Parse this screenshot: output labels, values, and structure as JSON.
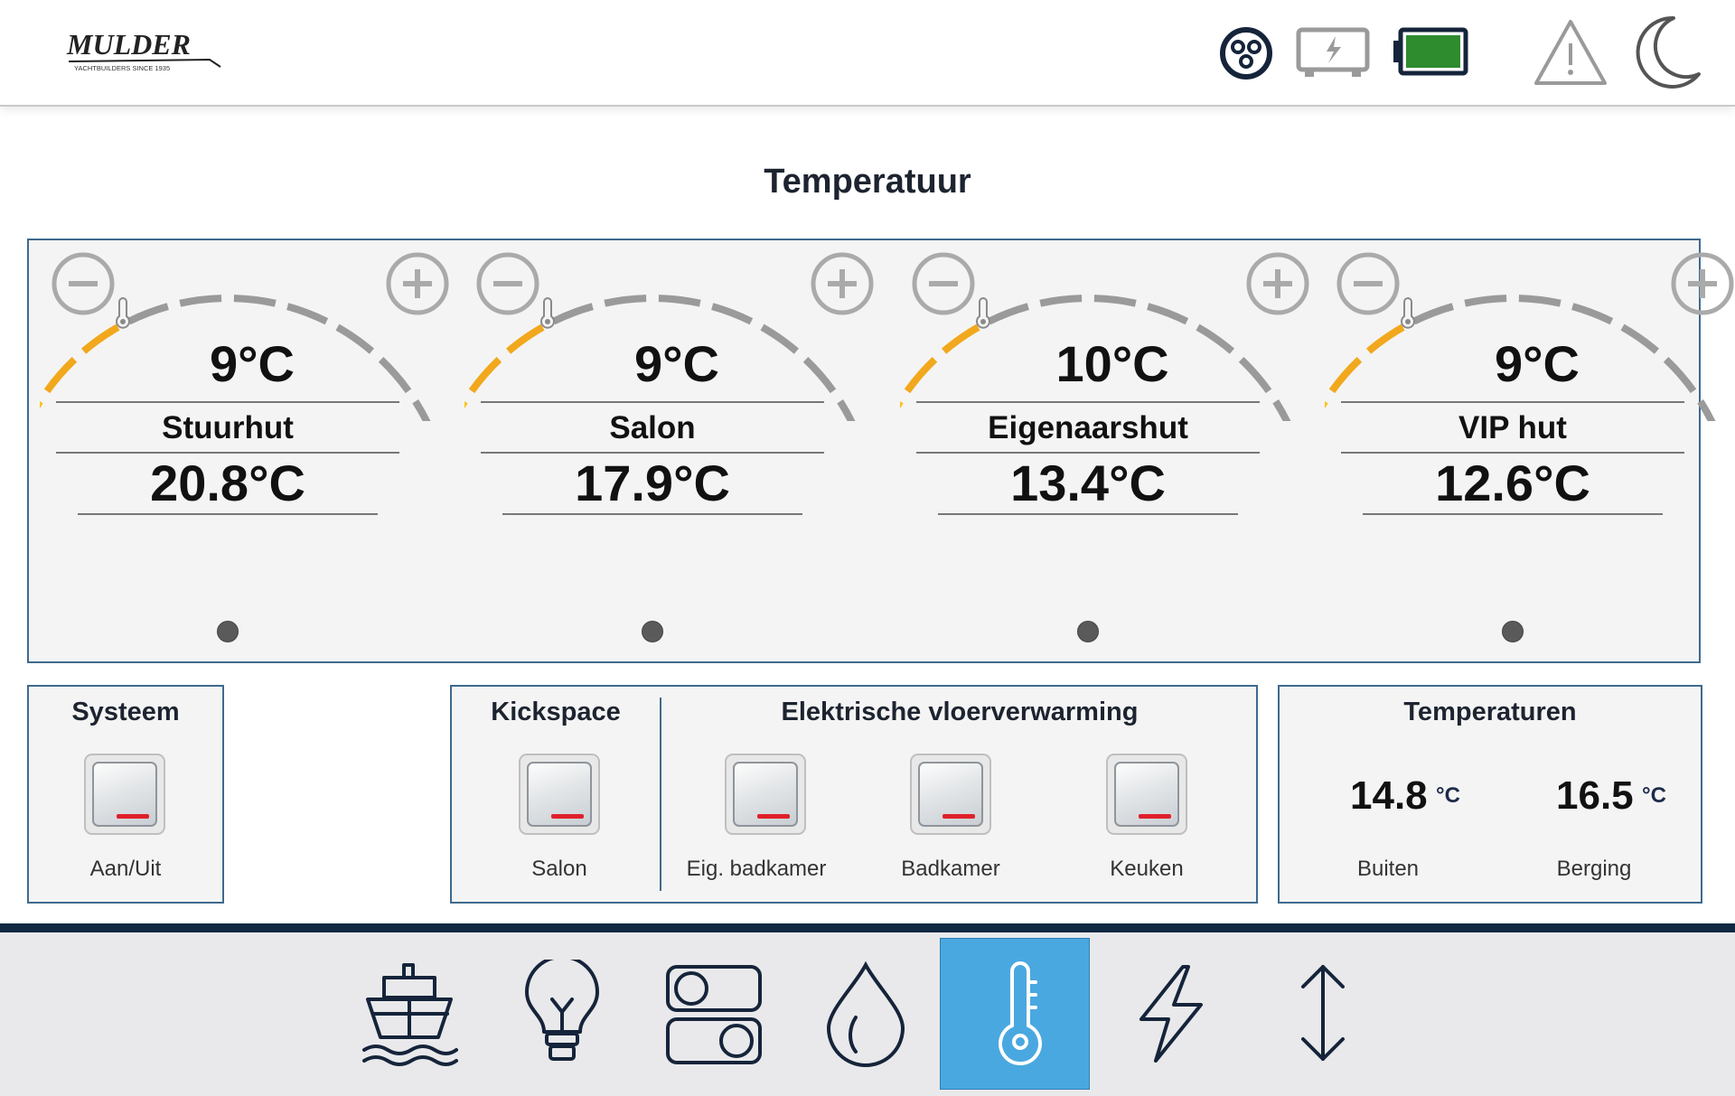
{
  "header": {
    "logo_text": "MULDER",
    "logo_subtext": "YACHTBUILDERS SINCE 1935",
    "status_icons": [
      "shore-power-icon",
      "charger-icon",
      "battery-icon",
      "warning-icon",
      "night-mode-icon"
    ],
    "battery_level": 1.0,
    "battery_color": "#2e8b2e"
  },
  "page": {
    "title": "Temperatuur"
  },
  "zones": [
    {
      "name": "Stuurhut",
      "setpoint": "9°C",
      "current": "20.8°C"
    },
    {
      "name": "Salon",
      "setpoint": "9°C",
      "current": "17.9°C"
    },
    {
      "name": "Eigenaarshut",
      "setpoint": "10°C",
      "current": "13.4°C"
    },
    {
      "name": "VIP hut",
      "setpoint": "9°C",
      "current": "12.6°C"
    }
  ],
  "systeem": {
    "title": "Systeem",
    "switch_label": "Aan/Uit",
    "state": "off"
  },
  "kickspace": {
    "title": "Kickspace",
    "switch_label": "Salon",
    "state": "off"
  },
  "vloer": {
    "title": "Elektrische vloerverwarming",
    "switches": [
      {
        "label": "Eig. badkamer",
        "state": "off"
      },
      {
        "label": "Badkamer",
        "state": "off"
      },
      {
        "label": "Keuken",
        "state": "off"
      }
    ]
  },
  "temperaturen": {
    "title": "Temperaturen",
    "items": [
      {
        "value": "14.8",
        "unit": "°C",
        "label": "Buiten"
      },
      {
        "value": "16.5",
        "unit": "°C",
        "label": "Berging"
      }
    ]
  },
  "nav": {
    "items": [
      "boat-icon",
      "lightbulb-icon",
      "switches-icon",
      "water-drop-icon",
      "thermometer-icon",
      "lightning-icon",
      "up-down-arrow-icon"
    ],
    "active": "thermometer-icon"
  },
  "colors": {
    "accent": "#4aa8e0",
    "panel_border": "#3f6a8e",
    "nav_dark": "#0f2943",
    "gauge_active": "#f2a81d",
    "gauge_inactive": "#9a9a9a",
    "switch_led": "#e0202a"
  }
}
